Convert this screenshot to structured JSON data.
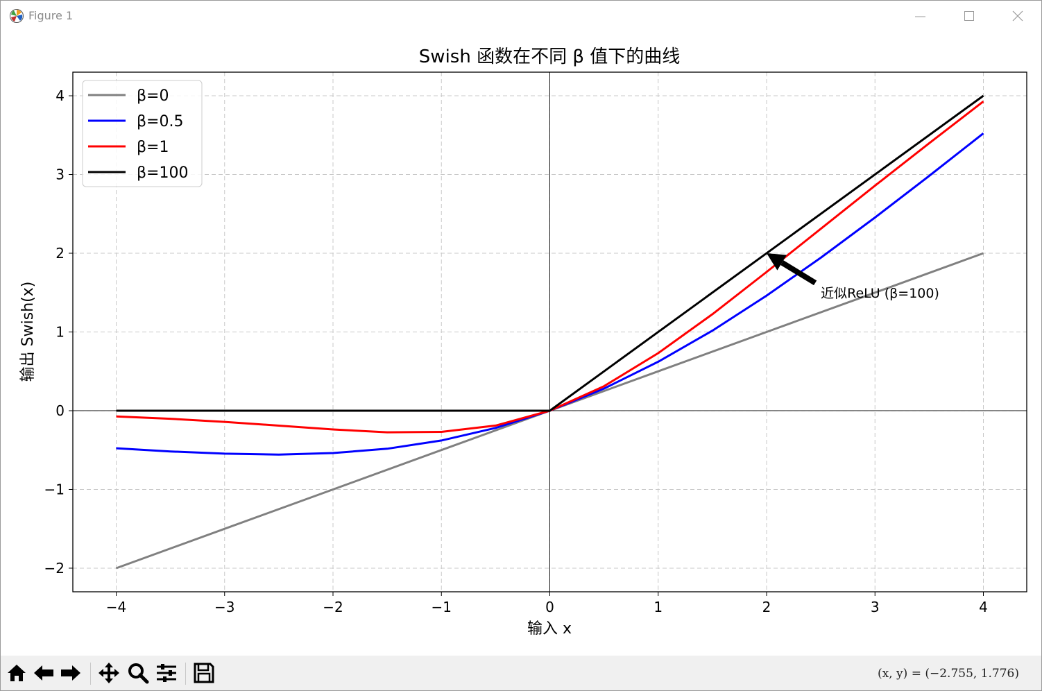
{
  "window": {
    "title": "Figure 1"
  },
  "toolbar": {
    "buttons": [
      "home-icon",
      "back-icon",
      "forward-icon",
      "pan-icon",
      "zoom-icon",
      "configure-subplots-icon",
      "save-icon"
    ],
    "coords": "(x, y) = (−2.755, 1.776)"
  },
  "chart_data": {
    "type": "line",
    "title": "Swish 函数在不同 β 值下的曲线",
    "xlabel": "输入 x",
    "ylabel": "输出 Swish(x)",
    "xlim": [
      -4.4,
      4.4
    ],
    "ylim": [
      -2.3,
      4.3
    ],
    "xticks": [
      -4,
      -3,
      -2,
      -1,
      0,
      1,
      2,
      3,
      4
    ],
    "yticks": [
      -2,
      -1,
      0,
      1,
      2,
      3,
      4
    ],
    "xtick_labels": [
      "−4",
      "−3",
      "−2",
      "−1",
      "0",
      "1",
      "2",
      "3",
      "4"
    ],
    "ytick_labels": [
      "−2",
      "−1",
      "0",
      "1",
      "2",
      "3",
      "4"
    ],
    "grid": true,
    "grid_style": "dashed",
    "reference_lines": [
      "x=0",
      "y=0"
    ],
    "legend_position": "top-left",
    "series": [
      {
        "name": "β=0",
        "color": "#808080",
        "x": [
          -4,
          -3,
          -2,
          -1,
          0,
          1,
          2,
          3,
          4
        ],
        "y": [
          -2.0,
          -1.5,
          -1.0,
          -0.5,
          0.0,
          0.5,
          1.0,
          1.5,
          2.0
        ]
      },
      {
        "name": "β=0.5",
        "color": "#0000ff",
        "x": [
          -4,
          -3.5,
          -3,
          -2.5,
          -2,
          -1.5,
          -1,
          -0.5,
          0,
          0.5,
          1,
          1.5,
          2,
          2.5,
          3,
          3.5,
          4
        ],
        "y": [
          -0.477,
          -0.517,
          -0.546,
          -0.557,
          -0.538,
          -0.483,
          -0.378,
          -0.219,
          0.0,
          0.281,
          0.622,
          1.017,
          1.462,
          1.943,
          2.454,
          2.983,
          3.523
        ]
      },
      {
        "name": "β=1",
        "color": "#ff0000",
        "x": [
          -4,
          -3.5,
          -3,
          -2.5,
          -2,
          -1.5,
          -1,
          -0.5,
          0,
          0.5,
          1,
          1.5,
          2,
          2.5,
          3,
          3.5,
          4
        ],
        "y": [
          -0.072,
          -0.102,
          -0.142,
          -0.19,
          -0.238,
          -0.274,
          -0.269,
          -0.189,
          0.0,
          0.311,
          0.731,
          1.226,
          1.762,
          2.31,
          2.858,
          3.398,
          3.928
        ]
      },
      {
        "name": "β=100",
        "color": "#000000",
        "x": [
          -4,
          0,
          4
        ],
        "y": [
          0.0,
          0.0,
          4.0
        ]
      }
    ],
    "annotations": [
      {
        "text": "近似ReLU (β=100)",
        "xy": [
          2,
          2
        ],
        "xytext": [
          2.5,
          1.5
        ],
        "arrow": true
      }
    ]
  }
}
